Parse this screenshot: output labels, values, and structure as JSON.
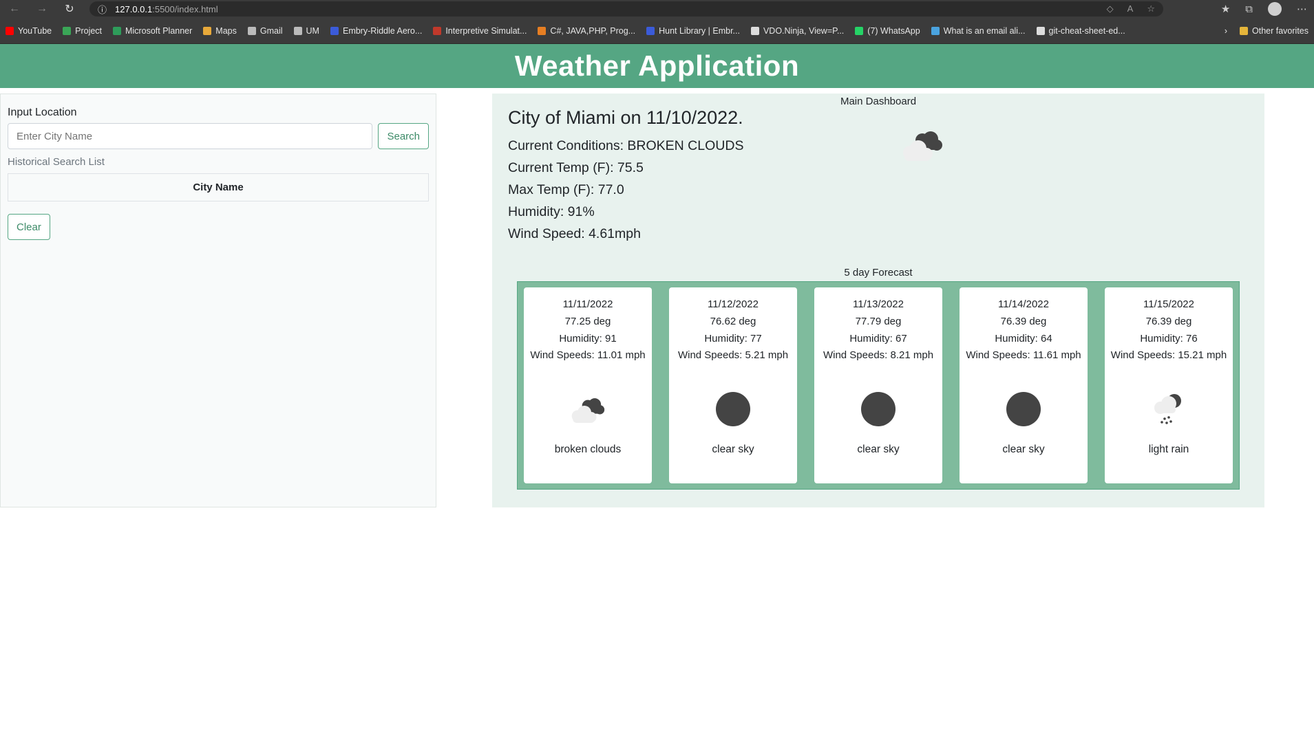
{
  "browser": {
    "url_host": "127.0.0.1",
    "url_rest": ":5500/index.html",
    "bookmarks": [
      {
        "label": "YouTube",
        "color": "#ff0000"
      },
      {
        "label": "Project",
        "color": "#3aa657"
      },
      {
        "label": "Microsoft Planner",
        "color": "#2e9c5a"
      },
      {
        "label": "Maps",
        "color": "#e8a93a"
      },
      {
        "label": "Gmail",
        "color": "#bbbbbb"
      },
      {
        "label": "UM",
        "color": "#bbbbbb"
      },
      {
        "label": "Embry-Riddle Aero...",
        "color": "#3b5bd9"
      },
      {
        "label": "Interpretive Simulat...",
        "color": "#c0392b"
      },
      {
        "label": "C#, JAVA,PHP, Prog...",
        "color": "#e67e22"
      },
      {
        "label": "Hunt Library | Embr...",
        "color": "#3b5bd9"
      },
      {
        "label": "VDO.Ninja, View=P...",
        "color": "#dddddd"
      },
      {
        "label": "(7) WhatsApp",
        "color": "#25d366"
      },
      {
        "label": "What is an email ali...",
        "color": "#4aa3df"
      },
      {
        "label": "git-cheat-sheet-ed...",
        "color": "#dddddd"
      }
    ],
    "other_favorites": "Other favorites"
  },
  "header": {
    "title": "Weather Application"
  },
  "search": {
    "label": "Input Location",
    "placeholder": "Enter City Name",
    "button": "Search",
    "history_label": "Historical Search List",
    "table_header": "City Name",
    "clear": "Clear"
  },
  "dashboard": {
    "caption": "Main Dashboard",
    "city_line": "City of Miami on 11/10/2022.",
    "conditions": "Current Conditions: BROKEN CLOUDS",
    "temp": "Current Temp (F): 75.5",
    "max_temp": "Max Temp (F): 77.0",
    "humidity": "Humidity: 91%",
    "wind": "Wind Speed: 4.61mph",
    "icon": "broken-clouds-icon"
  },
  "forecast": {
    "caption": "5 day Forecast",
    "days": [
      {
        "date": "11/11/2022",
        "temp": "77.25 deg",
        "humidity": "Humidity: 91",
        "wind": "Wind Speeds: 11.01 mph",
        "desc": "broken clouds",
        "icon": "broken-clouds-icon"
      },
      {
        "date": "11/12/2022",
        "temp": "76.62 deg",
        "humidity": "Humidity: 77",
        "wind": "Wind Speeds: 5.21 mph",
        "desc": "clear sky",
        "icon": "clear-sky-icon"
      },
      {
        "date": "11/13/2022",
        "temp": "77.79 deg",
        "humidity": "Humidity: 67",
        "wind": "Wind Speeds: 8.21 mph",
        "desc": "clear sky",
        "icon": "clear-sky-icon"
      },
      {
        "date": "11/14/2022",
        "temp": "76.39 deg",
        "humidity": "Humidity: 64",
        "wind": "Wind Speeds: 11.61 mph",
        "desc": "clear sky",
        "icon": "clear-sky-icon"
      },
      {
        "date": "11/15/2022",
        "temp": "76.39 deg",
        "humidity": "Humidity: 76",
        "wind": "Wind Speeds: 15.21 mph",
        "desc": "light rain",
        "icon": "light-rain-icon"
      }
    ]
  },
  "colors": {
    "accent": "#55a683",
    "forecast_bg": "#7fbb9d",
    "dashboard_bg": "#e8f2ee"
  }
}
